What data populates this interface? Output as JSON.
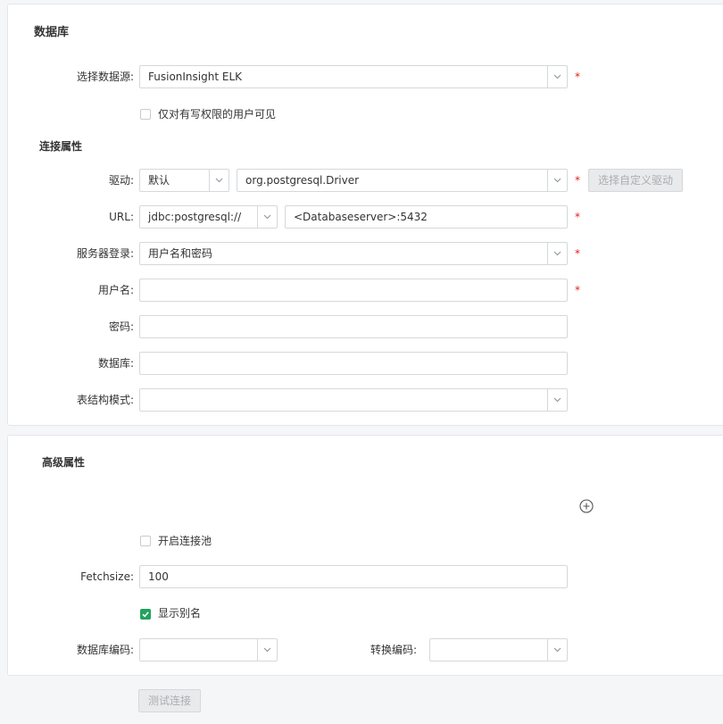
{
  "database_panel": {
    "title": "数据库",
    "datasource_label": "选择数据源:",
    "datasource_value": "FusionInsight ELK",
    "write_only_label": "仅对有写权限的用户可见",
    "connection_title": "连接属性",
    "driver_label": "驱动:",
    "driver_mode_value": "默认",
    "driver_class_value": "org.postgresql.Driver",
    "custom_driver_button": "选择自定义驱动",
    "url_label": "URL:",
    "url_prefix_value": "jdbc:postgresql://",
    "url_value": "<Databaseserver>:5432",
    "login_label": "服务器登录:",
    "login_value": "用户名和密码",
    "username_label": "用户名:",
    "username_value": "",
    "password_label": "密码:",
    "password_value": "",
    "database_label": "数据库:",
    "database_value": "",
    "schema_label": "表结构模式:",
    "schema_value": "",
    "required_mark": "*"
  },
  "advanced_panel": {
    "title": "高级属性",
    "pool_label": "开启连接池",
    "pool_checked": false,
    "fetchsize_label": "Fetchsize:",
    "fetchsize_value": "100",
    "alias_label": "显示别名",
    "alias_checked": true,
    "db_encoding_label": "数据库编码:",
    "db_encoding_value": "",
    "convert_encoding_label": "转换编码:",
    "convert_encoding_value": ""
  },
  "footer": {
    "test_button": "测试连接"
  },
  "colors": {
    "required": "#e02020",
    "checkbox_checked": "#21a35e",
    "border": "#d5d8dc"
  },
  "icons": {
    "select_arrow": "chevron-down-icon",
    "add": "plus-circle-icon",
    "check": "check-icon"
  }
}
